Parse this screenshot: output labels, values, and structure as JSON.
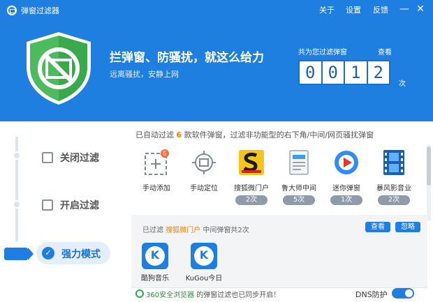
{
  "titlebar": {
    "app_title": "弹窗过滤器",
    "links": [
      "关于",
      "设置",
      "反馈"
    ],
    "minimize": "—",
    "close": "✕"
  },
  "hero": {
    "headline": "拦弹窗、防骚扰，就这么给力",
    "subline": "远离骚扰，安静上网",
    "count_label": "共为您过滤弹窗",
    "view_link": "查看",
    "digits": [
      "0",
      "0",
      "1",
      "2"
    ],
    "unit": "次"
  },
  "modes": [
    {
      "label": "关闭过滤",
      "icon": "checkbox-window-icon",
      "active": false
    },
    {
      "label": "开启过滤",
      "icon": "window-icon",
      "active": false
    },
    {
      "label": "强力模式",
      "icon": "check-circle-icon",
      "active": true
    }
  ],
  "summary": {
    "prefix": "已自动过滤",
    "count": "6",
    "suffix": "款软件弹窗，过滤非功能型的右下角/中间/网页骚扰弹窗"
  },
  "software": [
    {
      "name": "手动添加",
      "badge": "5",
      "icon": "add-dashed-icon"
    },
    {
      "name": "手动定位",
      "icon": "crosshair-icon"
    },
    {
      "name": "搜狐微门户",
      "count": "2次",
      "icon": "sohu-icon"
    },
    {
      "name": "鲁大师中间",
      "count": "5次",
      "icon": "document-icon"
    },
    {
      "name": "迷你弹窗",
      "count": "1次",
      "icon": "play-circle-icon"
    },
    {
      "name": "暴风影音业",
      "count": "2次",
      "icon": "film-icon"
    }
  ],
  "filtered": {
    "prefix": "已过滤",
    "highlight": "搜狐微门户",
    "suffix": "中间弹窗共2次",
    "view_btn": "查看",
    "ignore_btn": "忽略",
    "items": [
      {
        "name": "酷狗音乐",
        "glyph": "K"
      },
      {
        "name": "KuGou今日",
        "glyph": "K"
      }
    ]
  },
  "status": {
    "link": "360安全浏览器",
    "text": "的弹窗过滤也已同步开启！",
    "dns_label": "DNS防护"
  },
  "colors": {
    "primary": "#1f7fe0",
    "accent": "#ff7a00",
    "shield": "#49b85b"
  }
}
